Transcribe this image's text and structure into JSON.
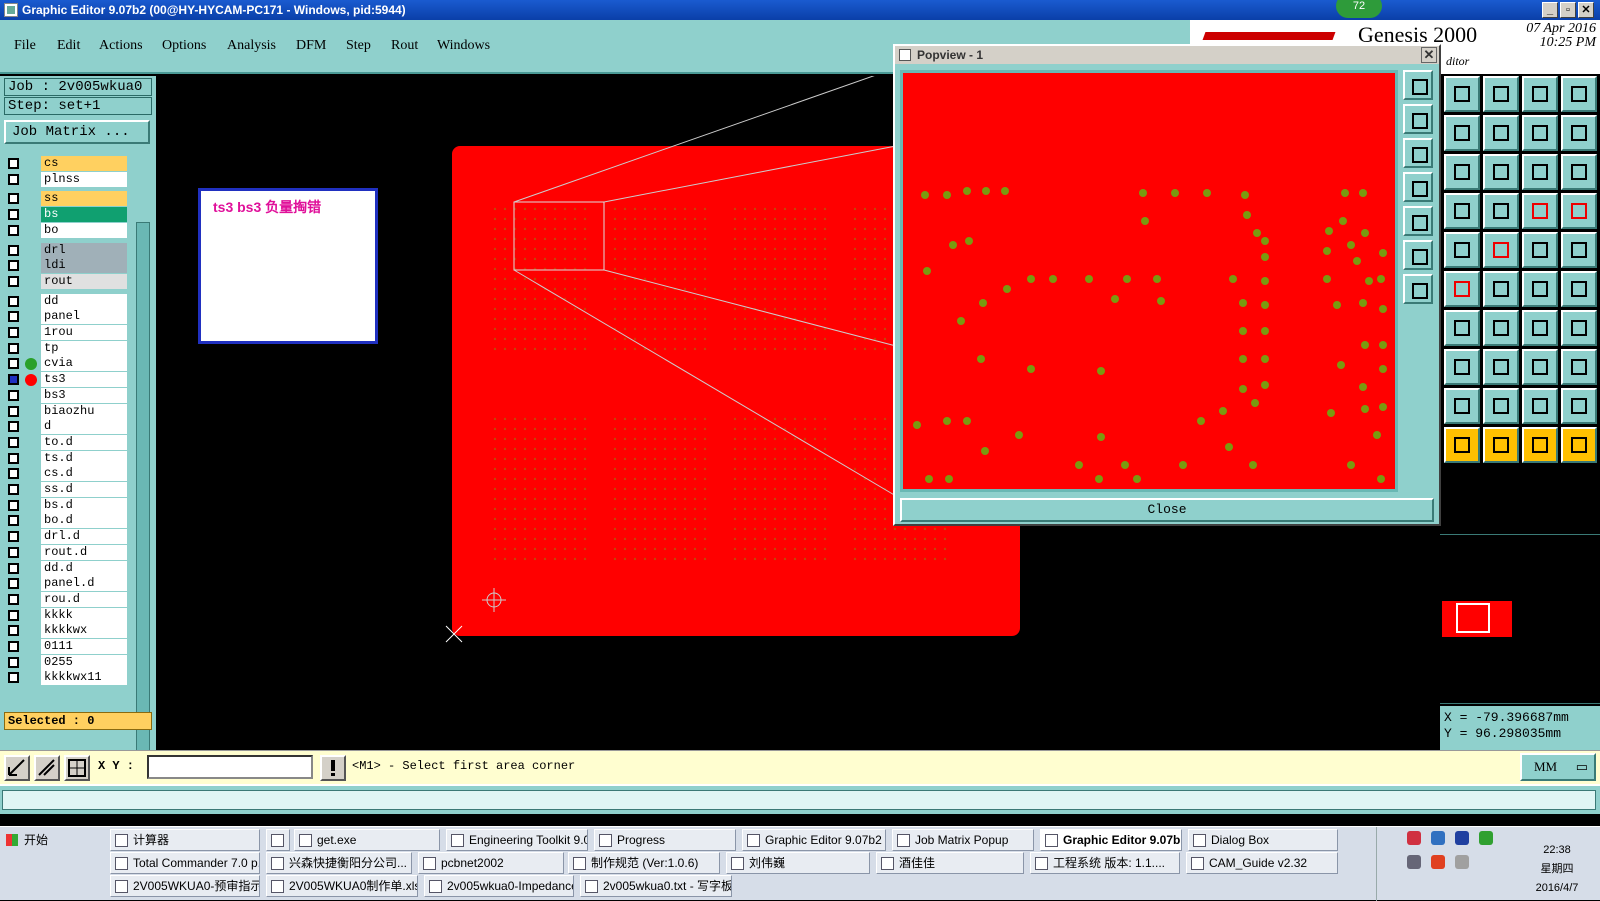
{
  "window": {
    "title": "Graphic Editor 9.07b2 (00@HY-HYCAM-PC171 - Windows, pid:5944)",
    "badge": "72",
    "controls": [
      "_",
      "▫",
      "✕"
    ]
  },
  "menu": [
    "File",
    "Edit",
    "Actions",
    "Options",
    "Analysis",
    "DFM",
    "Step",
    "Rout",
    "Windows"
  ],
  "header": {
    "brand": "Genesis 2000",
    "date": "07 Apr 2016",
    "time": "10:25 PM",
    "sub": "ditor"
  },
  "job": {
    "job_line": "Job : 2v005wkua0",
    "step_line": "Step: set+1",
    "job_matrix": "Job Matrix ...",
    "selected": "Selected : 0"
  },
  "layers": [
    {
      "name": "cs",
      "bg": "#ffd060"
    },
    {
      "name": "plnss",
      "bg": "#ffffff"
    },
    {
      "name": "ss",
      "bg": "#ffd060"
    },
    {
      "name": "bs",
      "bg": "#10a070"
    },
    {
      "name": "bo",
      "bg": "#ffffff"
    },
    {
      "name": "drl",
      "bg": "#a0b0b8"
    },
    {
      "name": "ldi",
      "bg": "#a0b0b8"
    },
    {
      "name": "rout",
      "bg": "#e0e0e0"
    },
    {
      "name": "dd",
      "bg": "#ffffff"
    },
    {
      "name": "panel",
      "bg": "#ffffff"
    },
    {
      "name": "1rou",
      "bg": "#ffffff"
    },
    {
      "name": "tp",
      "bg": "#ffffff"
    },
    {
      "name": "cvia",
      "bg": "#ffffff",
      "dot": "#2aa02a"
    },
    {
      "name": "ts3",
      "bg": "#ffffff",
      "dot": "#ff0000"
    },
    {
      "name": "bs3",
      "bg": "#ffffff"
    },
    {
      "name": "biaozhu",
      "bg": "#ffffff"
    },
    {
      "name": "d",
      "bg": "#ffffff"
    },
    {
      "name": "to.d",
      "bg": "#ffffff"
    },
    {
      "name": "ts.d",
      "bg": "#ffffff"
    },
    {
      "name": "cs.d",
      "bg": "#ffffff"
    },
    {
      "name": "ss.d",
      "bg": "#ffffff"
    },
    {
      "name": "bs.d",
      "bg": "#ffffff"
    },
    {
      "name": "bo.d",
      "bg": "#ffffff"
    },
    {
      "name": "drl.d",
      "bg": "#ffffff"
    },
    {
      "name": "rout.d",
      "bg": "#ffffff"
    },
    {
      "name": "dd.d",
      "bg": "#ffffff"
    },
    {
      "name": "panel.d",
      "bg": "#ffffff"
    },
    {
      "name": "rou.d",
      "bg": "#ffffff"
    },
    {
      "name": "kkkk",
      "bg": "#ffffff"
    },
    {
      "name": "kkkkwx",
      "bg": "#ffffff"
    },
    {
      "name": "0111",
      "bg": "#ffffff"
    },
    {
      "name": "0255",
      "bg": "#ffffff"
    },
    {
      "name": "kkkkwx11",
      "bg": "#ffffff"
    }
  ],
  "annotation": "ts3  bs3 负量掏错",
  "popview": {
    "title": "Popview - 1",
    "close": "Close"
  },
  "coords": {
    "x": "X = -79.396687mm",
    "y": "Y = 96.298035mm"
  },
  "status": {
    "xy_label": "X Y :",
    "message": "<M1> - Select first area corner",
    "units": "MM"
  },
  "taskbar": {
    "start": "开始",
    "row1": [
      "计算器",
      "",
      "get.exe",
      "Engineering Toolkit 9.0...",
      "Progress",
      "Graphic Editor 9.07b2 (...",
      "Job Matrix Popup",
      "Graphic Editor 9.07b...",
      "Dialog Box"
    ],
    "row2": [
      "Total Commander 7.0 p...",
      "兴森快捷衡阳分公司...",
      "pcbnet2002",
      "制作规范 (Ver:1.0.6)",
      "刘伟巍",
      "酒佳佳",
      "工程系统  版本: 1.1....",
      "CAM_Guide v2.32"
    ],
    "row3": [
      "2V005WKUA0-预审指示...",
      "2V005WKUA0制作单.xls...",
      "2v005wkua0-Impedance...",
      "2v005wkua0.txt - 写字板"
    ],
    "clock_time": "22:38",
    "clock_day": "星期四",
    "clock_date": "2016/4/7"
  },
  "colors": {
    "board": "#ff0000",
    "pad": "#7a9a10",
    "panel": "#8fd0cc"
  }
}
